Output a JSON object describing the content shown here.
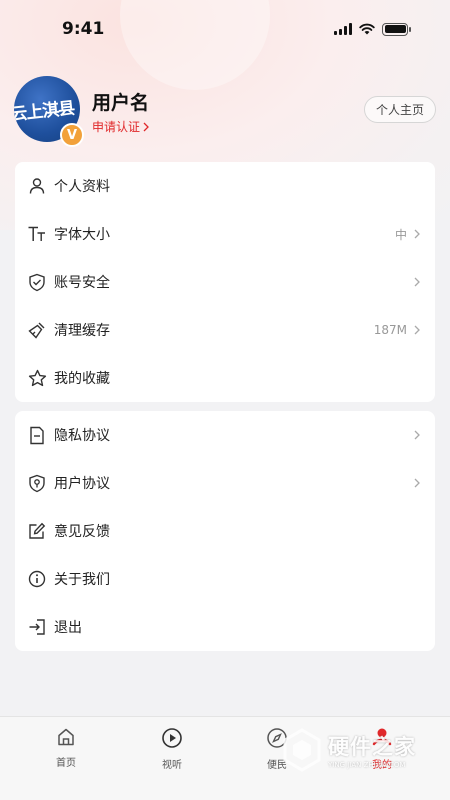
{
  "status_bar": {
    "time": "9:41"
  },
  "profile": {
    "avatar_text": "云上淇县",
    "badge": "V",
    "username": "用户名",
    "verify_label": "申请认证",
    "home_button": "个人主页"
  },
  "menu_group_1": [
    {
      "label": "个人资料",
      "icon": "user-icon",
      "value": "",
      "chevron": false
    },
    {
      "label": "字体大小",
      "icon": "font-size-icon",
      "value": "中",
      "chevron": true
    },
    {
      "label": "账号安全",
      "icon": "shield-check-icon",
      "value": "",
      "chevron": true
    },
    {
      "label": "清理缓存",
      "icon": "broom-icon",
      "value": "187M",
      "chevron": true
    },
    {
      "label": "我的收藏",
      "icon": "star-icon",
      "value": "",
      "chevron": false
    }
  ],
  "menu_group_2": [
    {
      "label": "隐私协议",
      "icon": "document-icon",
      "value": "",
      "chevron": true
    },
    {
      "label": "用户协议",
      "icon": "shield-user-icon",
      "value": "",
      "chevron": true
    },
    {
      "label": "意见反馈",
      "icon": "edit-icon",
      "value": "",
      "chevron": false
    },
    {
      "label": "关于我们",
      "icon": "info-icon",
      "value": "",
      "chevron": false
    },
    {
      "label": "退出",
      "icon": "logout-icon",
      "value": "",
      "chevron": false
    }
  ],
  "tab_bar": [
    {
      "label": "首页",
      "icon": "home-icon",
      "active": false
    },
    {
      "label": "视听",
      "icon": "play-icon",
      "active": false
    },
    {
      "label": "便民",
      "icon": "compass-icon",
      "active": false
    },
    {
      "label": "我的",
      "icon": "profile-icon",
      "active": true
    }
  ],
  "watermark": {
    "title": "硬件之家",
    "subtitle": "YING JIAN ZHI JIA.COM"
  },
  "colors": {
    "accent": "#e0282a",
    "badge": "#f2a13a",
    "avatar": "#1e4f9c"
  }
}
